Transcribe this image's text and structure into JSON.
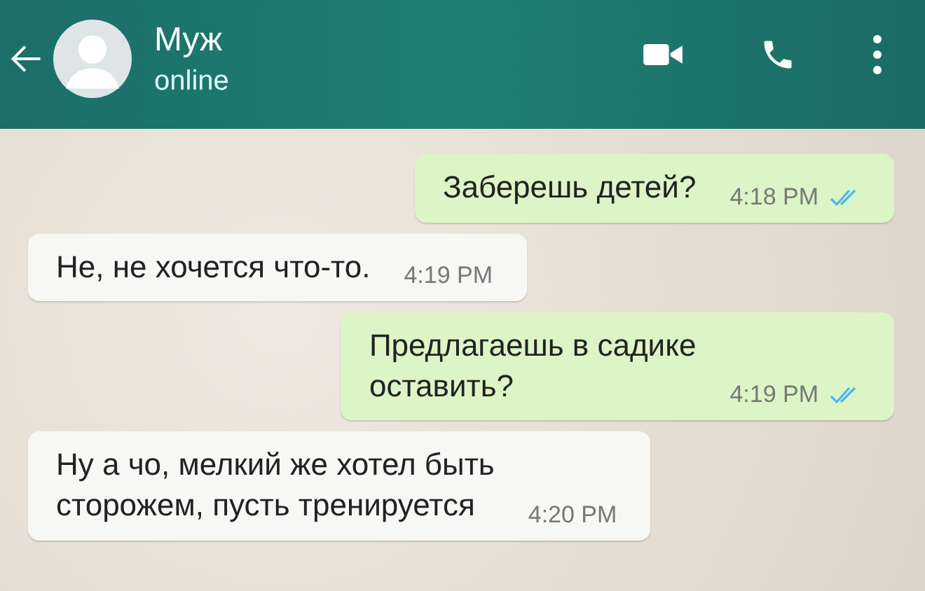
{
  "header": {
    "name": "Муж",
    "status": "online"
  },
  "messages": [
    {
      "kind": "out",
      "text": "Заберешь детей?",
      "time": "4:18 PM",
      "read": true
    },
    {
      "kind": "in",
      "text": "Не, не хочется что-то.",
      "time": "4:19 PM"
    },
    {
      "kind": "out",
      "text": "Предлагаешь в садике\nоставить?",
      "time": "4:19 PM",
      "read": true
    },
    {
      "kind": "in",
      "text": "Ну а чо, мелкий же хотел быть\nсторожем, пусть тренируется",
      "time": "4:20 PM"
    }
  ]
}
